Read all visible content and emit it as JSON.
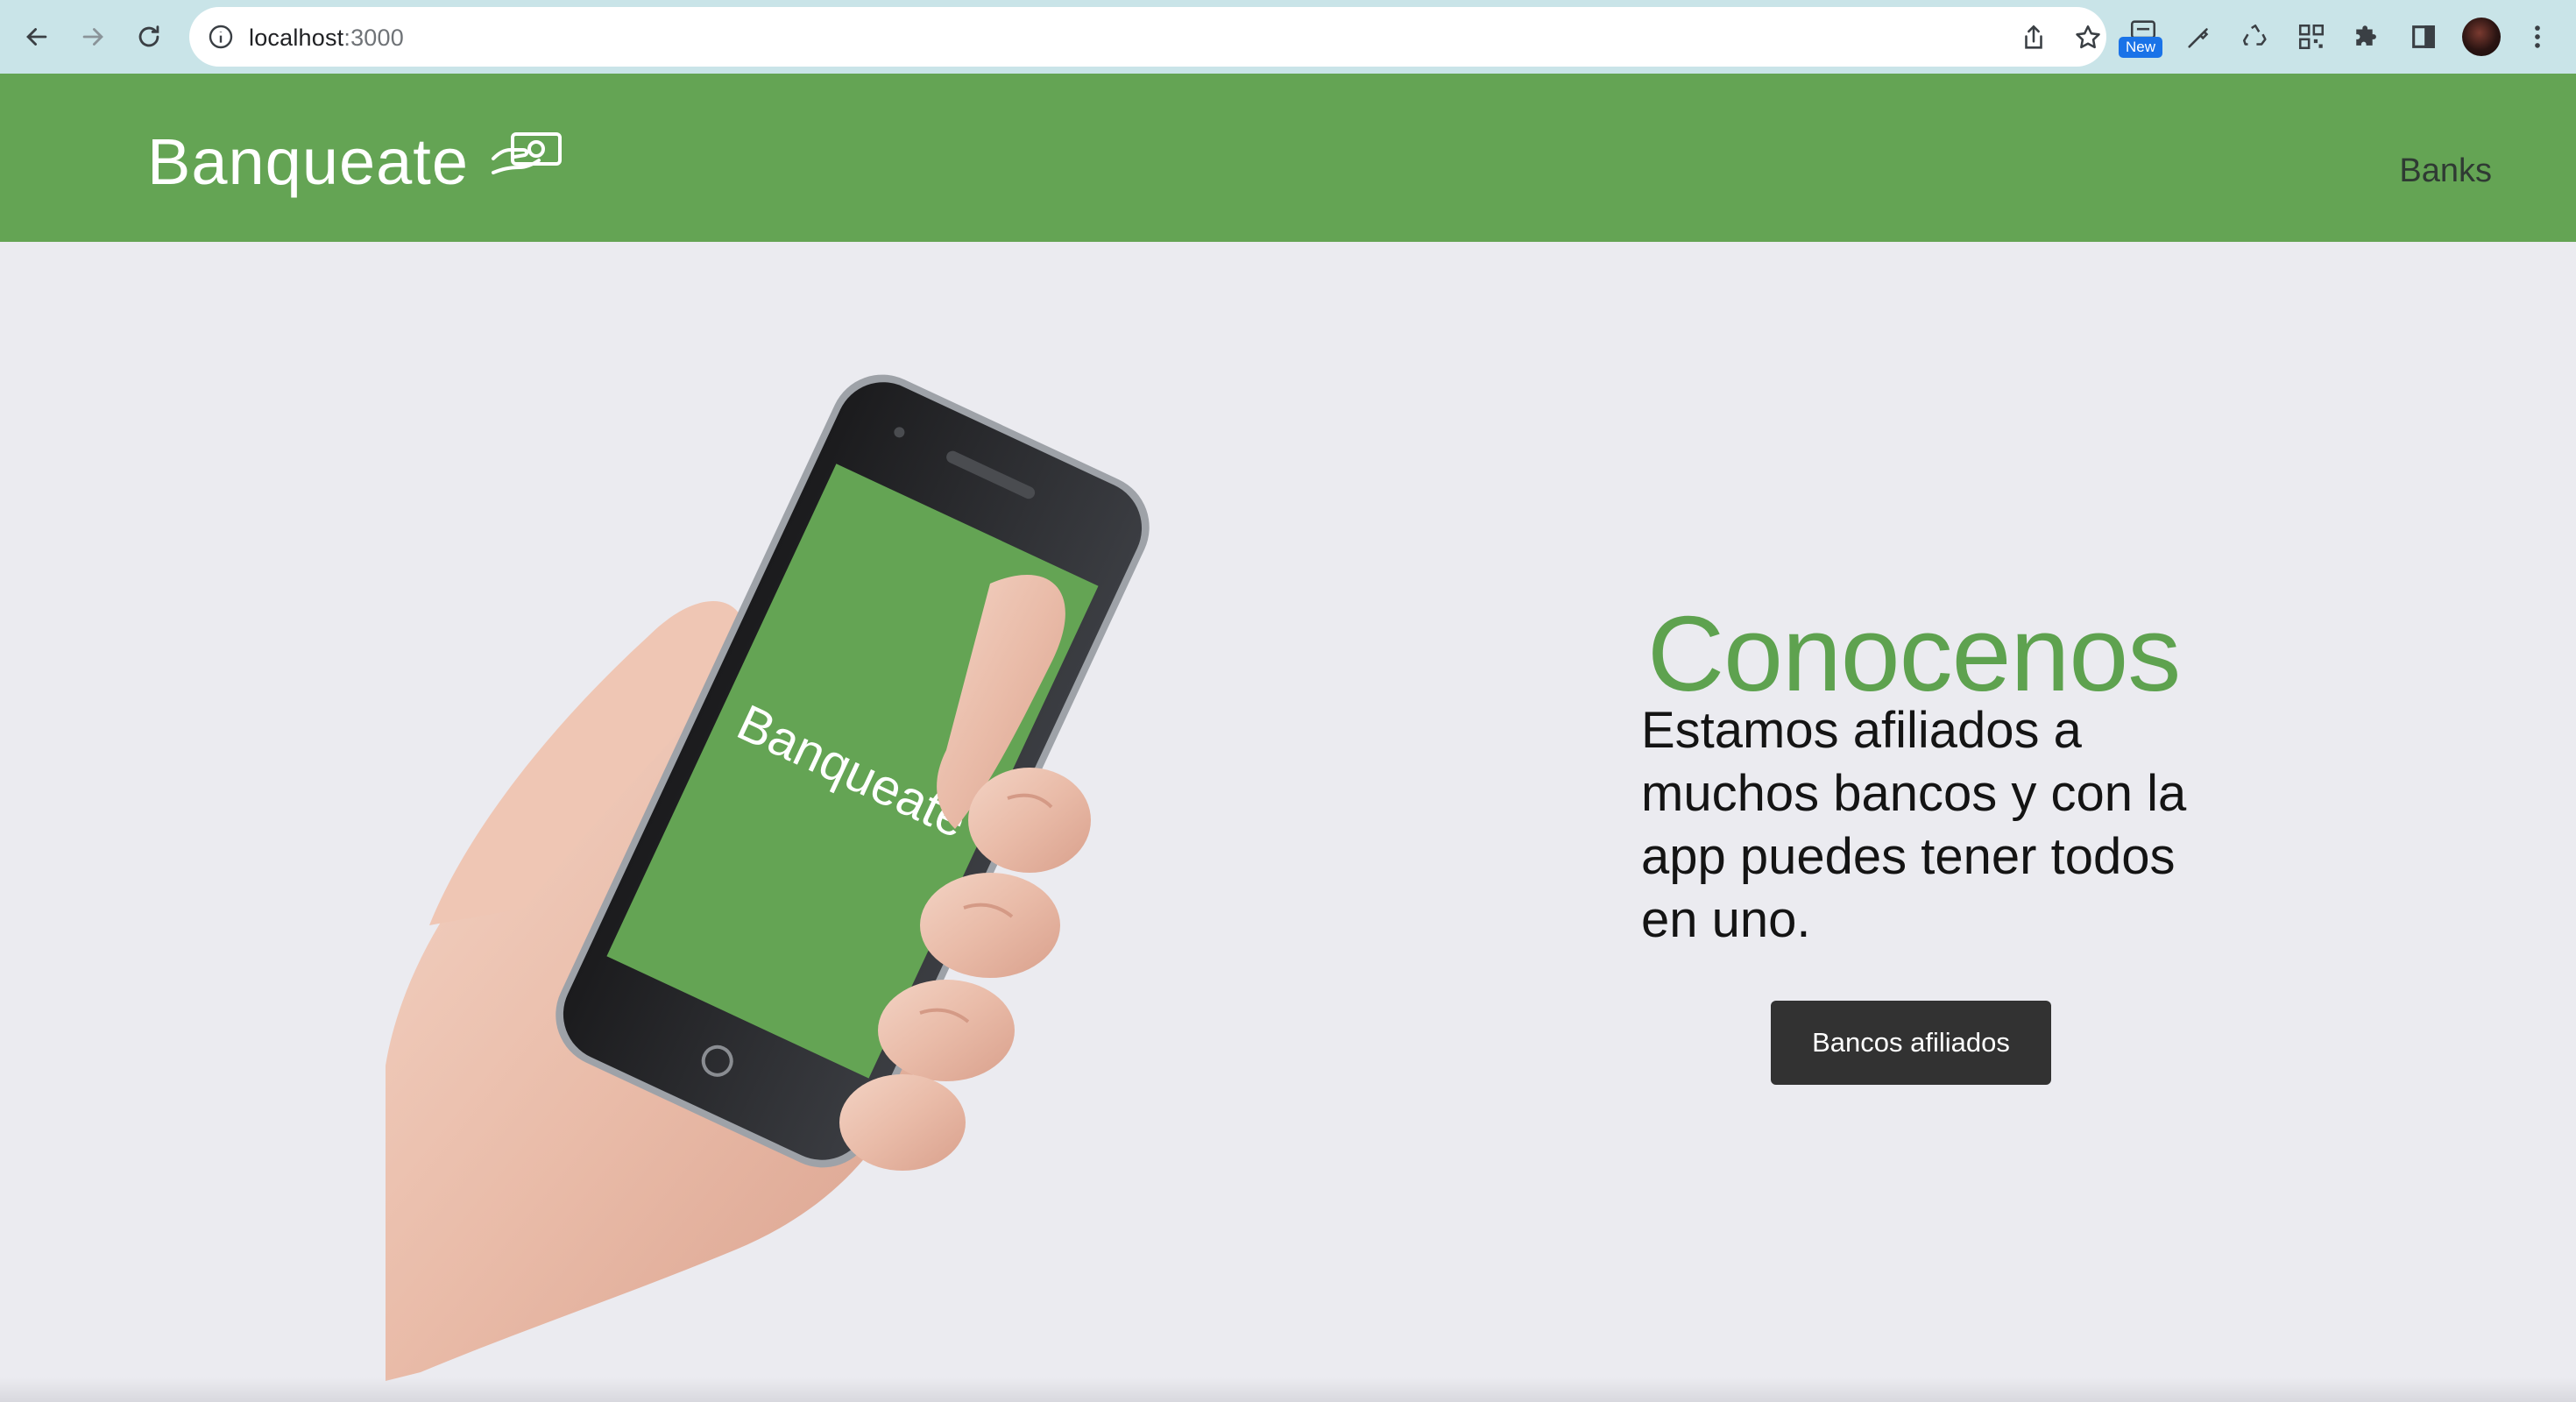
{
  "browser": {
    "url_host": "localhost",
    "url_port": ":3000",
    "new_badge": "New"
  },
  "header": {
    "brand": "Banqueate",
    "nav_link": "Banks",
    "background": "#64a454"
  },
  "hero": {
    "phone_brand": "Banqueate",
    "title": "Conocenos",
    "text": "Estamos afiliados a muchos bancos y con la app puedes tener todos en uno.",
    "button": "Bancos afiliados",
    "accent": "#5ea24f"
  }
}
